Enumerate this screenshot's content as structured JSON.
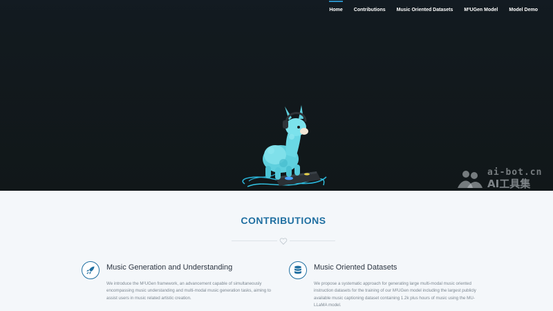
{
  "nav": {
    "items": [
      "Home",
      "Contributions",
      "Music Oriented Datasets",
      "M²UGen Model",
      "Model Demo"
    ],
    "active_index": 0
  },
  "watermark": {
    "line1": "ai-bot.cn",
    "line2": "AI工具集"
  },
  "contributions": {
    "title": "CONTRIBUTIONS",
    "cards": [
      {
        "title": "Music Generation and Understanding",
        "icon": "rocket-icon",
        "text": "We introduce the M²UGen framework, an advancement capable of simultaneously encompassing music understanding and multi-modal music generation tasks, aiming to assist users in music related artistic creation."
      },
      {
        "title": "Music Oriented Datasets",
        "icon": "database-icon",
        "text": "We propose a systematic approach for generating large multi-modal music oriented instruction datasets for the training of our M²UGen model including the largest publicly available music captioning dataset containing 1.2k plus hours of music using the MU-LLaMA model."
      }
    ]
  },
  "colors": {
    "accent": "#1f6fa1",
    "hero_bg": "#121a1f",
    "section_bg": "#f4f7fa"
  }
}
